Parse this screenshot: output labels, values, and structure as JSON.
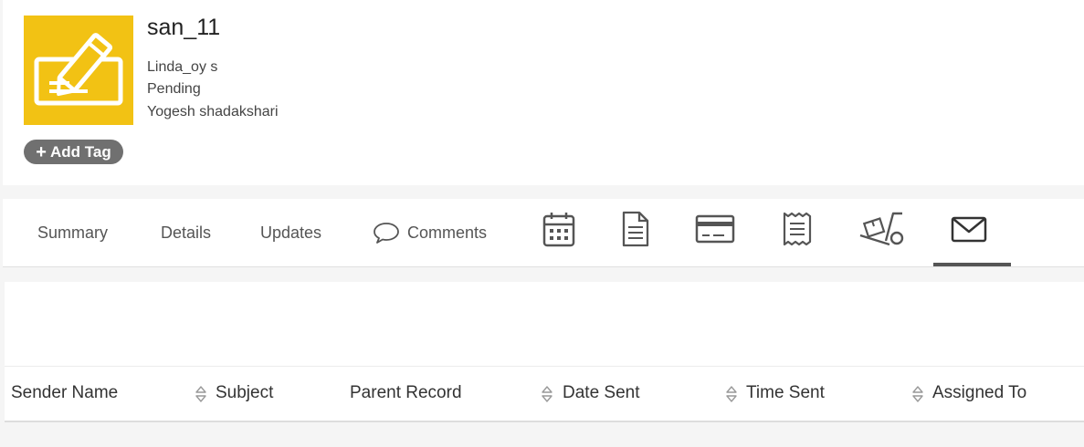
{
  "record": {
    "title": "san_11",
    "owner": "Linda_oy s",
    "status": "Pending",
    "assignee": "Yogesh shadakshari",
    "add_tag_label": "Add Tag"
  },
  "tabs": {
    "summary": "Summary",
    "details": "Details",
    "updates": "Updates",
    "comments": "Comments",
    "icons": [
      "calendar-icon",
      "document-icon",
      "credit-card-icon",
      "receipt-icon",
      "shipping-cart-icon",
      "mail-icon"
    ],
    "active": "mail-icon"
  },
  "table": {
    "columns": [
      "Sender Name",
      "Subject",
      "Parent Record",
      "Date Sent",
      "Time Sent",
      "Assigned To"
    ]
  },
  "colors": {
    "logo_bg": "#f2c214",
    "tag_bg": "#707070",
    "active_tab_bar": "#555555"
  }
}
